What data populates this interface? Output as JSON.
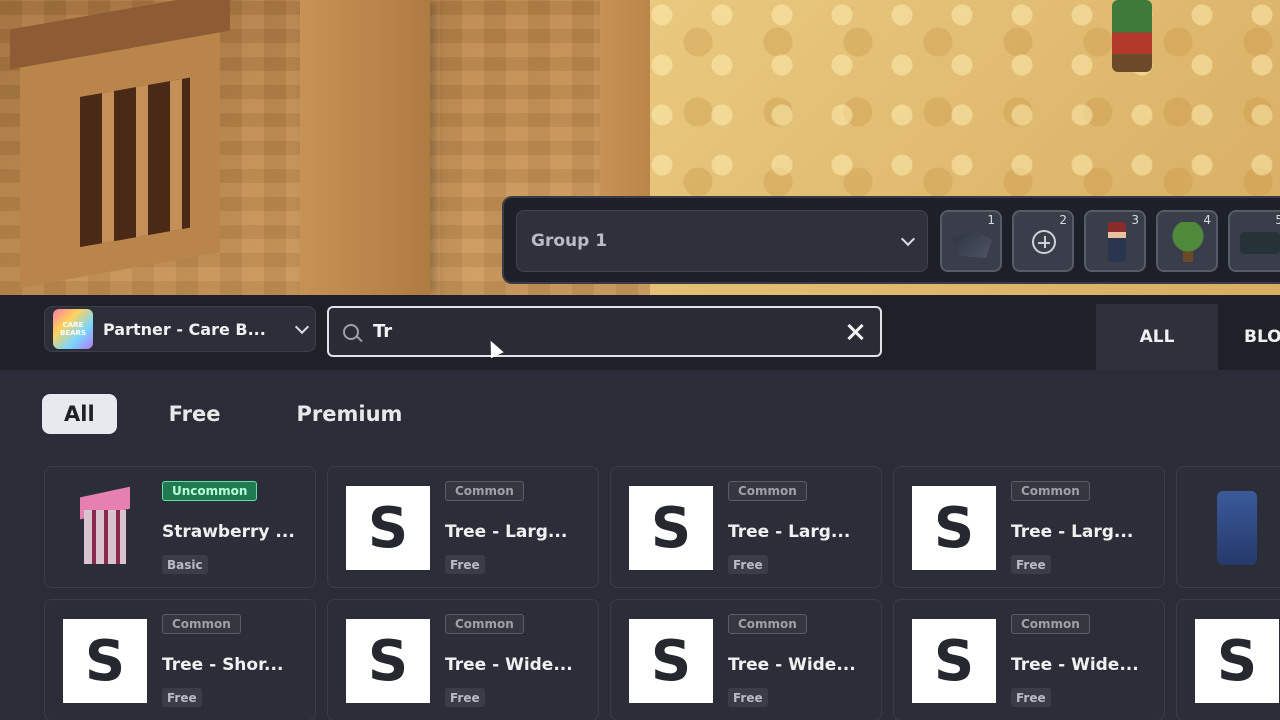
{
  "hotbar": {
    "group_label": "Group 1",
    "slots": [
      {
        "number": "1",
        "icon": "wolf-icon"
      },
      {
        "number": "2",
        "icon": "plus-icon"
      },
      {
        "number": "3",
        "icon": "character-icon"
      },
      {
        "number": "4",
        "icon": "tree-icon"
      },
      {
        "number": "5",
        "icon": "car-icon"
      }
    ]
  },
  "header": {
    "partner_name": "Partner - Care B...",
    "partner_logo_text": "CARE BEARS",
    "search_value": "Tr",
    "category_tabs": [
      "ALL",
      "BLO"
    ]
  },
  "filters": [
    "All",
    "Free",
    "Premium"
  ],
  "items": [
    {
      "rarity": "Uncommon",
      "title": "Strawberry ...",
      "tag": "Basic",
      "thumb": "house"
    },
    {
      "rarity": "Common",
      "title": "Tree - Larg...",
      "tag": "Free",
      "thumb": "S"
    },
    {
      "rarity": "Common",
      "title": "Tree - Larg...",
      "tag": "Free",
      "thumb": "S"
    },
    {
      "rarity": "Common",
      "title": "Tree - Larg...",
      "tag": "Free",
      "thumb": "S"
    },
    {
      "rarity": "",
      "title": "",
      "tag": "",
      "thumb": "camera"
    },
    {
      "rarity": "Common",
      "title": "Tree - Shor...",
      "tag": "Free",
      "thumb": "S"
    },
    {
      "rarity": "Common",
      "title": "Tree - Wide...",
      "tag": "Free",
      "thumb": "S"
    },
    {
      "rarity": "Common",
      "title": "Tree - Wide...",
      "tag": "Free",
      "thumb": "S"
    },
    {
      "rarity": "Common",
      "title": "Tree - Wide...",
      "tag": "Free",
      "thumb": "S"
    },
    {
      "rarity": "",
      "title": "",
      "tag": "",
      "thumb": "S"
    }
  ],
  "colors": {
    "panel_bg": "#2a2d37",
    "card_bg": "#2b2e38",
    "uncommon": "#1f7a52",
    "accent_text": "#f0f0f0"
  }
}
